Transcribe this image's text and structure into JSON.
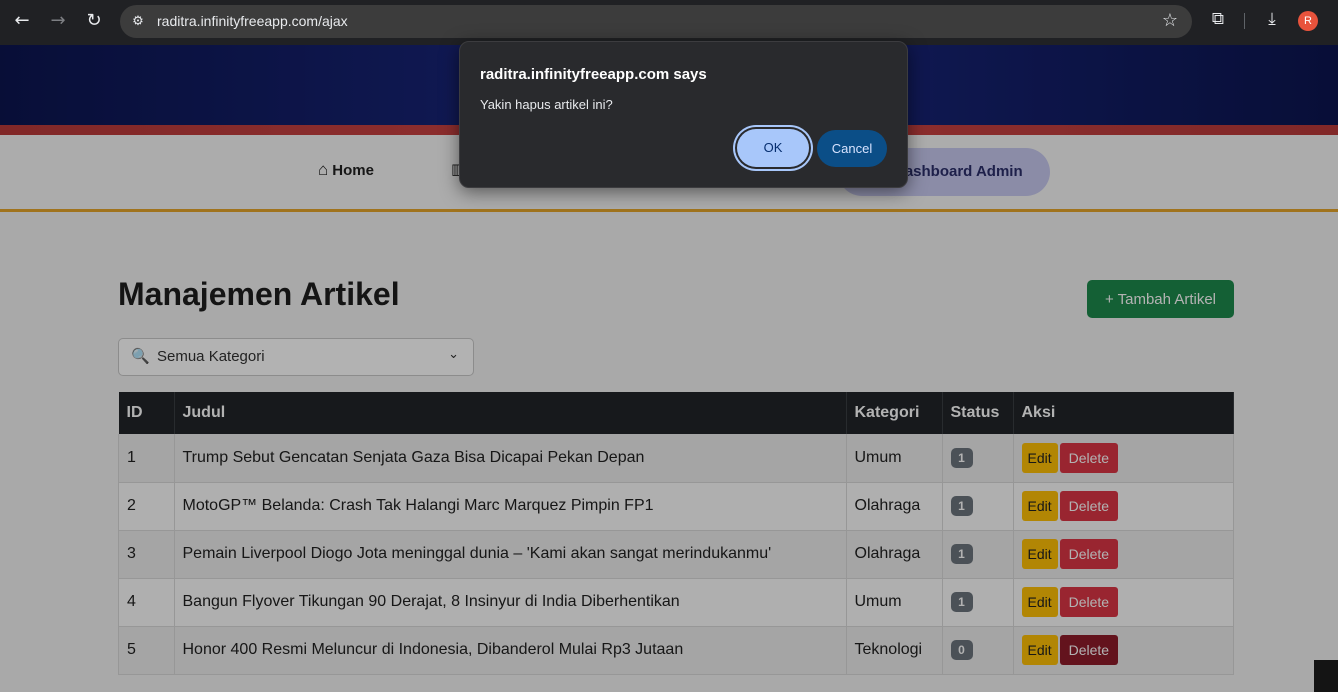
{
  "browser": {
    "back_icon": "←",
    "forward_icon": "→",
    "reload_icon": "↻",
    "site_info_icon": "⚙",
    "url": "raditra.infinityfreeapp.com/ajax",
    "star_icon": "☆",
    "extensions_icon": "⧉",
    "download_icon": "⤓",
    "profile_initial": "R"
  },
  "topnav": {
    "home_label": "Home",
    "home_icon": "⌂",
    "second_icon": "▥",
    "dashboard_label": "Dashboard Admin"
  },
  "main": {
    "title": "Manajemen Artikel",
    "add_button": "+ Tambah Artikel",
    "filter": {
      "icon": "🔍",
      "selected": "Semua Kategori",
      "chevron": "⌄"
    }
  },
  "table": {
    "headers": [
      "ID",
      "Judul",
      "Kategori",
      "Status",
      "Aksi"
    ],
    "rows": [
      {
        "id": "1",
        "judul": "Trump Sebut Gencatan Senjata Gaza Bisa Dicapai Pekan Depan",
        "kategori": "Umum",
        "status": "1"
      },
      {
        "id": "2",
        "judul": "MotoGP™ Belanda: Crash Tak Halangi Marc Marquez Pimpin FP1",
        "kategori": "Olahraga",
        "status": "1"
      },
      {
        "id": "3",
        "judul": "Pemain Liverpool Diogo Jota meninggal dunia – 'Kami akan sangat merindukanmu'",
        "kategori": "Olahraga",
        "status": "1"
      },
      {
        "id": "4",
        "judul": "Bangun Flyover Tikungan 90 Derajat, 8 Insinyur di India Diberhentikan",
        "kategori": "Umum",
        "status": "1"
      },
      {
        "id": "5",
        "judul": "Honor 400 Resmi Meluncur di Indonesia, Dibanderol Mulai Rp3 Jutaan",
        "kategori": "Teknologi",
        "status": "0"
      }
    ],
    "edit_label": "Edit",
    "delete_label": "Delete"
  },
  "dialog": {
    "title": "raditra.infinityfreeapp.com says",
    "message": "Yakin hapus artikel ini?",
    "ok_label": "OK",
    "cancel_label": "Cancel"
  }
}
